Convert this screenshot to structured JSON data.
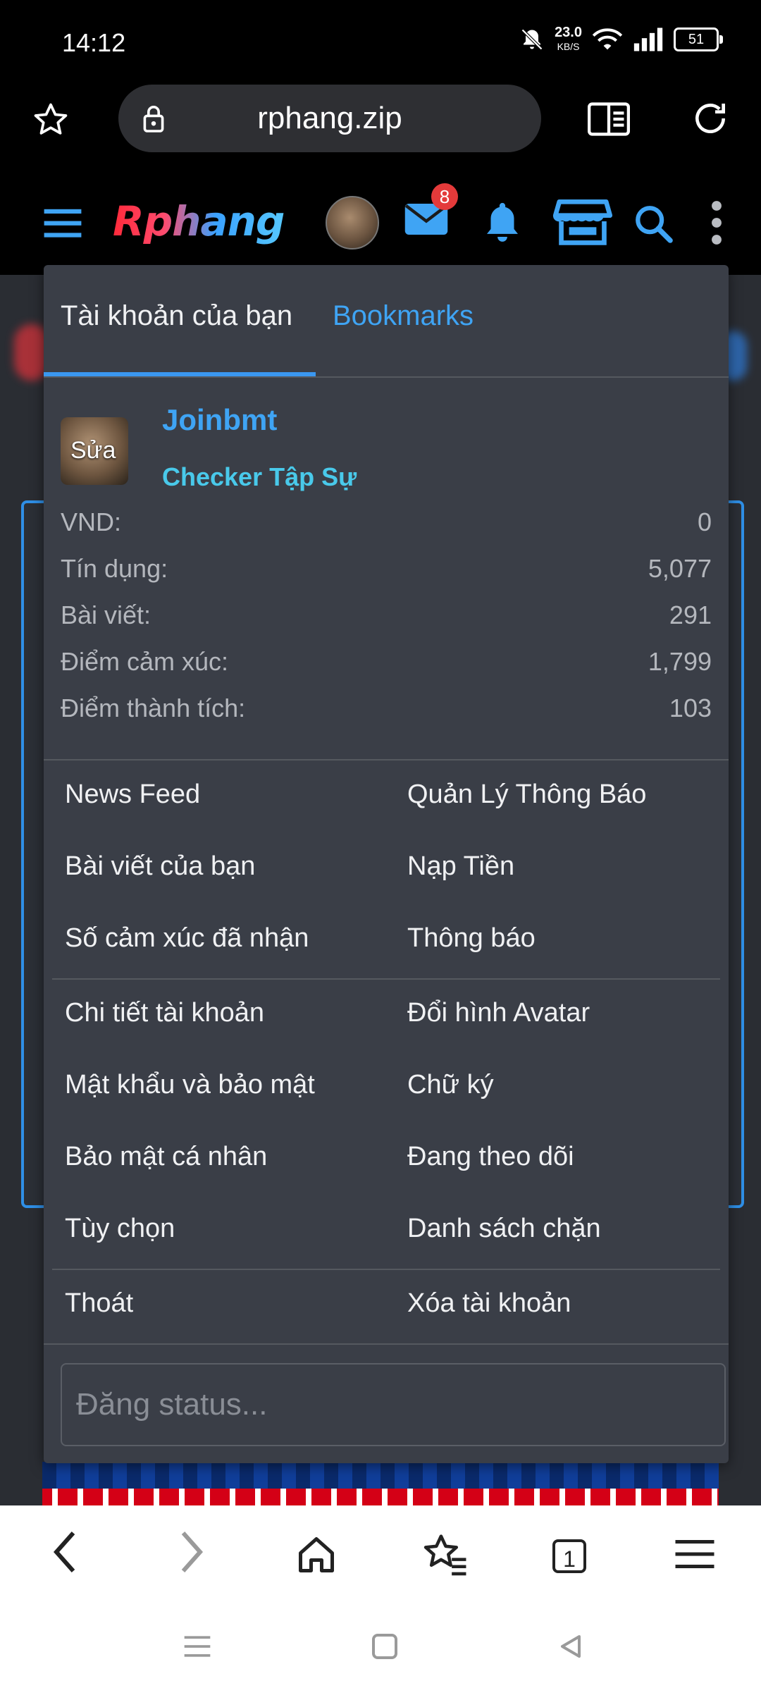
{
  "status_bar": {
    "time": "14:12",
    "net_speed": "23.0",
    "net_unit": "KB/S",
    "battery": "51"
  },
  "browser": {
    "url": "rphang.zip",
    "tab_count": "1"
  },
  "site": {
    "logo": "Rphang",
    "inbox_badge": "8"
  },
  "menu": {
    "tabs": [
      "Tài khoản của bạn",
      "Bookmarks"
    ],
    "profile": {
      "edit_label": "Sửa",
      "username": "Joinbmt",
      "title": "Checker Tập Sự"
    },
    "stats": [
      {
        "label": "VND:",
        "value": "0"
      },
      {
        "label": "Tín dụng:",
        "value": "5,077"
      },
      {
        "label": "Bài viết:",
        "value": "291"
      },
      {
        "label": "Điểm cảm xúc:",
        "value": "1,799"
      },
      {
        "label": "Điểm thành tích:",
        "value": "103"
      }
    ],
    "links_group1": [
      [
        "News Feed",
        "Quản Lý Thông Báo"
      ],
      [
        "Bài viết của bạn",
        "Nạp Tiền"
      ],
      [
        "Số cảm xúc đã nhận",
        "Thông báo"
      ]
    ],
    "links_group2": [
      [
        "Chi tiết tài khoản",
        "Đổi hình Avatar"
      ],
      [
        "Mật khẩu và bảo mật",
        "Chữ ký"
      ],
      [
        "Bảo mật cá nhân",
        "Đang theo dõi"
      ],
      [
        "Tùy chọn",
        "Danh sách chặn"
      ]
    ],
    "links_group3": [
      [
        "Thoát",
        "Xóa tài khoản"
      ]
    ],
    "status_placeholder": "Đăng status..."
  },
  "colors": {
    "accent": "#3fa4f4",
    "user_title": "#49c9ea",
    "menu_bg": "#3a3e47",
    "badge": "#e43a3a"
  }
}
